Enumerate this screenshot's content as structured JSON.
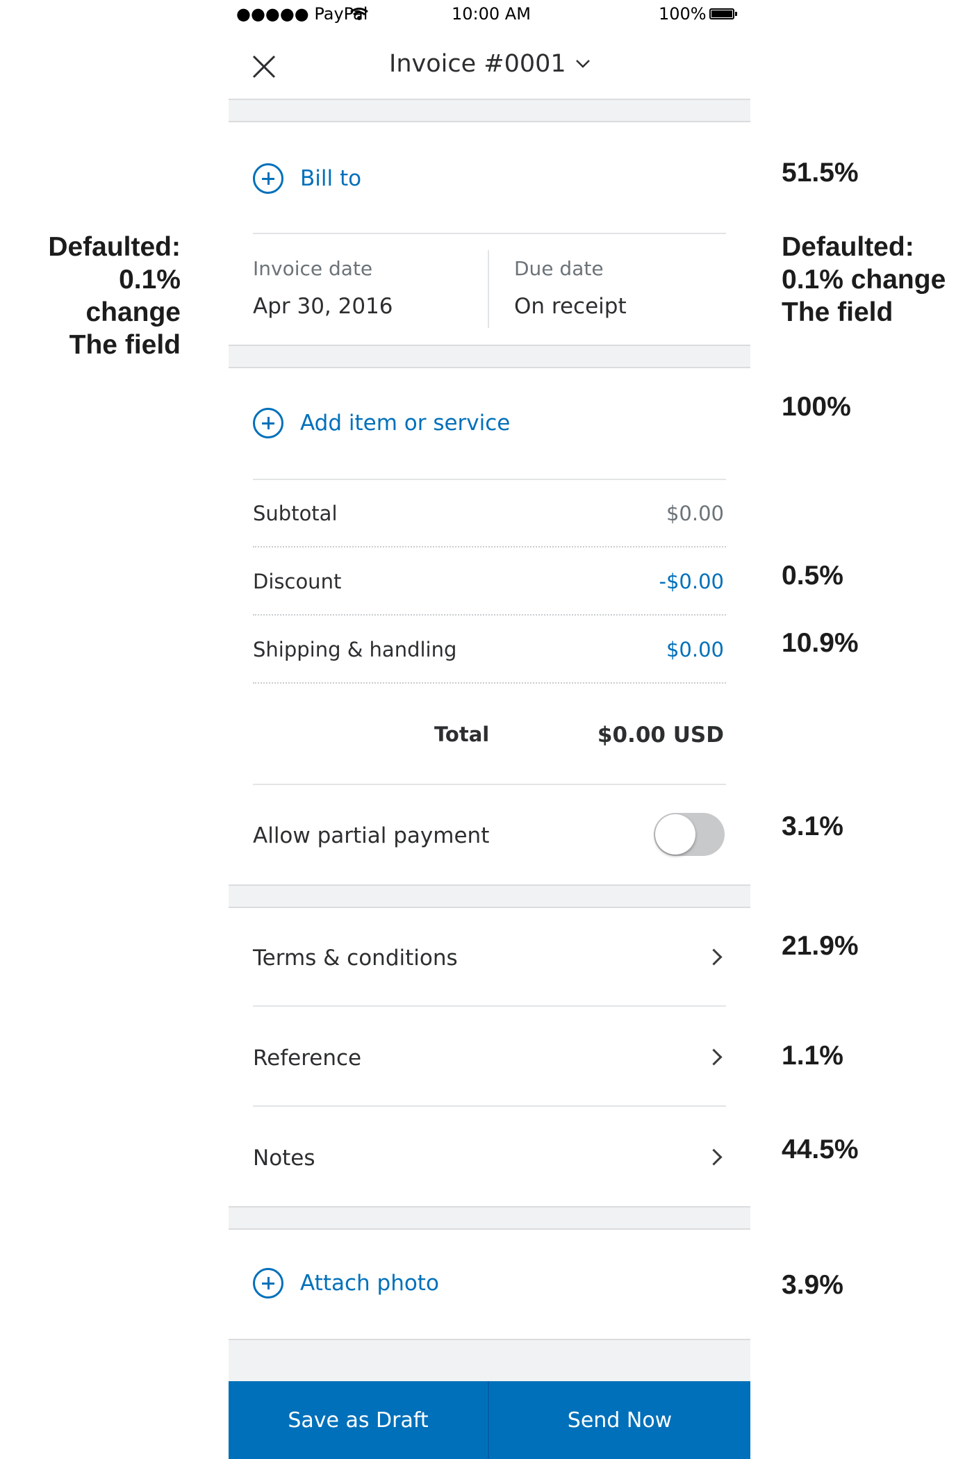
{
  "status_bar": {
    "carrier": "●●●●● PayPal",
    "time": "10:00 AM",
    "battery": "100%"
  },
  "header": {
    "title": "Invoice #0001"
  },
  "bill_to": {
    "label": "Bill to"
  },
  "dates": {
    "invoice_label": "Invoice date",
    "invoice_value": "Apr 30, 2016",
    "due_label": "Due date",
    "due_value": "On receipt"
  },
  "add_item": {
    "label": "Add item or service"
  },
  "summary": {
    "subtotal_label": "Subtotal",
    "subtotal_value": "$0.00",
    "discount_label": "Discount",
    "discount_value": "-$0.00",
    "shipping_label": "Shipping & handling",
    "shipping_value": "$0.00",
    "total_label": "Total",
    "total_value": "$0.00 USD"
  },
  "partial_payment": {
    "label": "Allow partial payment",
    "enabled": false
  },
  "menu": {
    "terms": "Terms & conditions",
    "reference": "Reference",
    "notes": "Notes"
  },
  "attach": {
    "label": "Attach photo"
  },
  "footer": {
    "save_draft": "Save as Draft",
    "send_now": "Send Now"
  },
  "annotations": {
    "left_dates": [
      "Defaulted:",
      "0.1% change",
      "The field"
    ],
    "right_dates": [
      "Defaulted:",
      "0.1% change",
      "The field"
    ],
    "bill_to": "51.5%",
    "add_item": "100%",
    "discount": "0.5%",
    "shipping": "10.9%",
    "partial_payment": "3.1%",
    "terms": "21.9%",
    "reference": "1.1%",
    "notes": "44.5%",
    "attach": "3.9%"
  },
  "colors": {
    "accent": "#0070ba",
    "text": "#2c2e2f",
    "muted": "#6c7378",
    "toggle_off": "#c8c9cb"
  }
}
